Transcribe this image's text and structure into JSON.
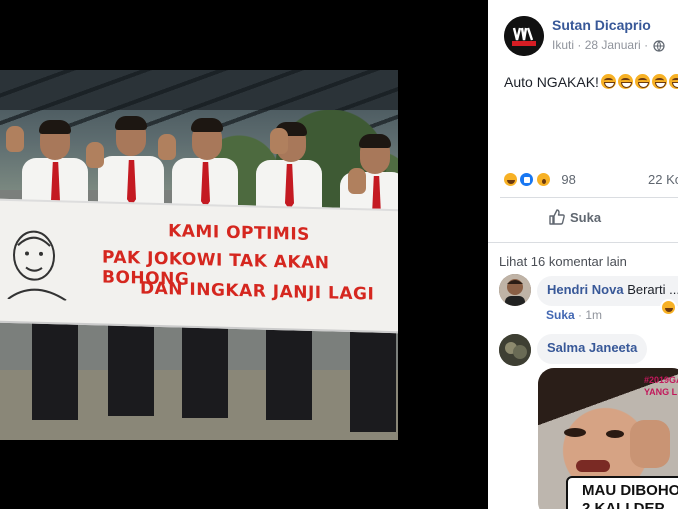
{
  "viewer": {
    "banner": {
      "line1": "KAMI OPTIMIS",
      "line2": "PAK JOKOWI TAK AKAN BOHONG",
      "line3": "DAN INGKAR JANJI LAGI"
    }
  },
  "post": {
    "page_name": "Sutan Dicaprio",
    "follow_label": "Ikuti",
    "separator": " · ",
    "date": "28 Januari",
    "separator2": " · ",
    "text": "Auto NGAKAK!",
    "emoji_count": 5,
    "reaction_count": "98",
    "comment_count": "22 Ko",
    "like_button_label": "Suka"
  },
  "comments": {
    "more_label": "Lihat 16 komentar lain",
    "items": [
      {
        "author": "Hendri Nova",
        "text": " Berarti ...",
        "like_label": "Suka",
        "separator": " · ",
        "time": "1m"
      },
      {
        "author": "Salma Janeeta",
        "meme_tag_line1": "#2019GA",
        "meme_tag_line2": "YANG L",
        "meme_caption_line1": "MAU DIBOHO",
        "meme_caption_line2": "2 KALI DEP"
      }
    ]
  },
  "colors": {
    "link_blue": "#385898",
    "banner_red": "#d5271f",
    "meta_gray": "#90949c",
    "like_blue": "#1877f2"
  }
}
